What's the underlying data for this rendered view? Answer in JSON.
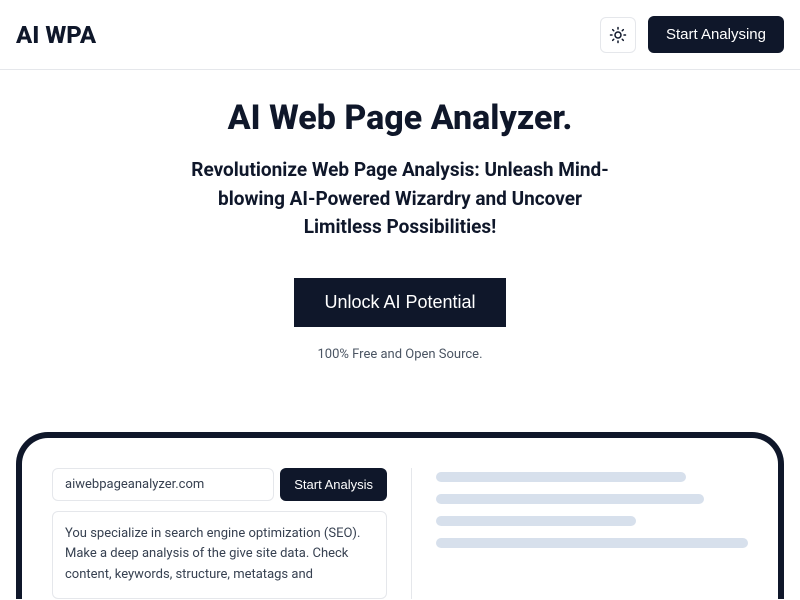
{
  "header": {
    "logo": "AI WPA",
    "start_button": "Start Analysing"
  },
  "hero": {
    "title": "AI Web Page Analyzer.",
    "subtitle": "Revolutionize Web Page Analysis: Unleash Mind-blowing AI-Powered Wizardry and Uncover Limitless Possibilities!",
    "cta": "Unlock AI Potential",
    "footnote": "100% Free and Open Source."
  },
  "analyzer": {
    "url_value": "aiwebpageanalyzer.com",
    "action_button": "Start Analysis",
    "description": "You specialize in search engine optimization (SEO). Make a deep analysis of the give site data. Check content, keywords, structure, metatags and"
  }
}
